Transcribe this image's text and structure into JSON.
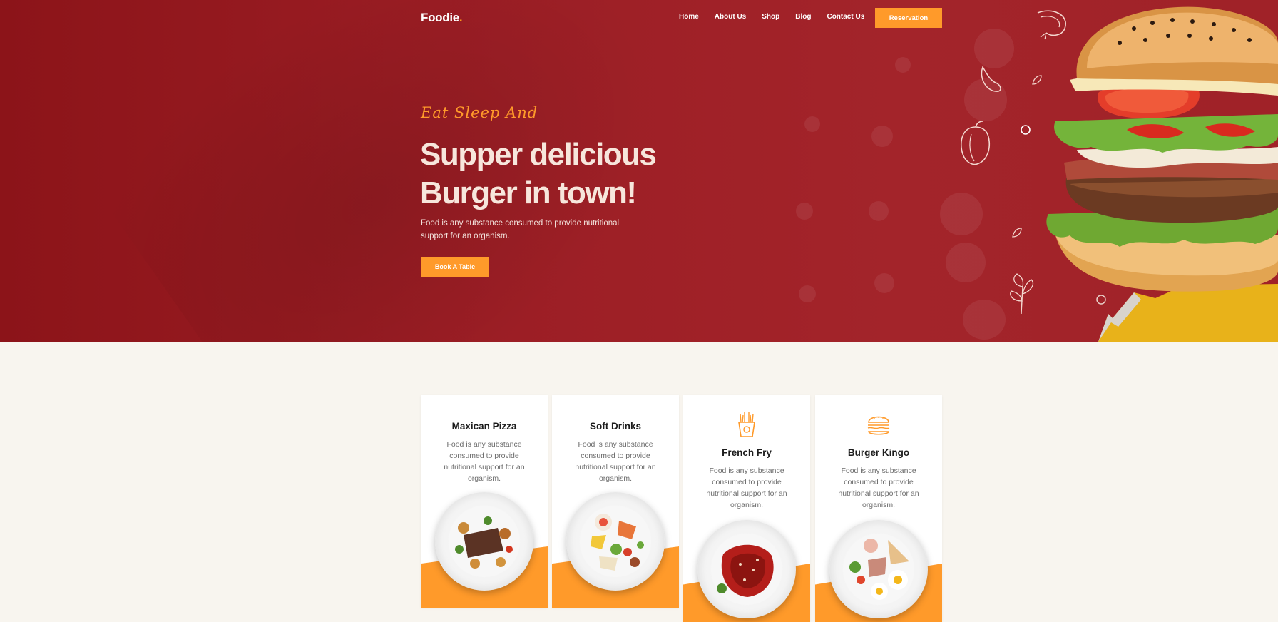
{
  "brand": {
    "name": "Foodie",
    "dot": "."
  },
  "nav": {
    "items": [
      "Home",
      "About Us",
      "Shop",
      "Blog",
      "Contact Us"
    ],
    "cta": "Reservation"
  },
  "hero": {
    "tagline": "Eat Sleep And",
    "headline_line1": "Supper delicious",
    "headline_line2": "Burger in town!",
    "description": "Food is any substance consumed to provide nutritional support for an organism.",
    "button": "Book A Table"
  },
  "cards": [
    {
      "title": "Maxican Pizza",
      "desc": "Food is any substance consumed to provide nutritional support for an organism.",
      "icon": "none"
    },
    {
      "title": "Soft Drinks",
      "desc": "Food is any substance consumed to provide nutritional support for an organism.",
      "icon": "none"
    },
    {
      "title": "French Fry",
      "desc": "Food is any substance consumed to provide nutritional support for an organism.",
      "icon": "fries-icon"
    },
    {
      "title": "Burger Kingo",
      "desc": "Food is any substance consumed to provide nutritional support for an organism.",
      "icon": "burger-icon"
    }
  ],
  "colors": {
    "hero_red": "#9b1d24",
    "accent_orange": "#ff9a2a",
    "page_bg": "#f8f5ef",
    "headline": "#f7e6dc"
  }
}
